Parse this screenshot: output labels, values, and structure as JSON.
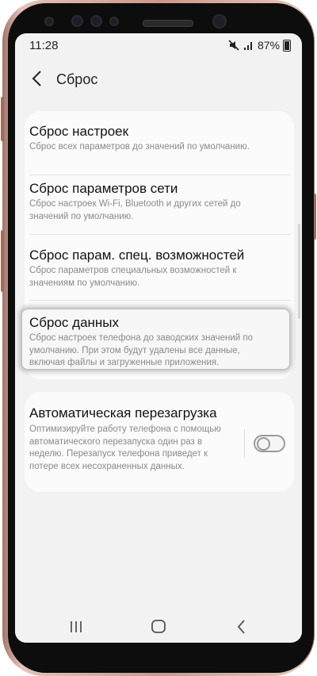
{
  "status_bar": {
    "time": "11:28",
    "battery": "87%"
  },
  "header": {
    "title": "Сброс"
  },
  "items": [
    {
      "title": "Сброс настроек",
      "description": "Сброс всех параметров до значений по умолчанию."
    },
    {
      "title": "Сброс параметров сети",
      "description": "Сброс настроек Wi-Fi, Bluetooth и других сетей до значений по умолчанию."
    },
    {
      "title": "Сброс парам. спец. возможностей",
      "description": "Сброс параметров специальных возможностей к значениям по умолчанию."
    },
    {
      "title": "Сброс данных",
      "description": "Сброс настроек телефона до заводских значений по умолчанию. При этом будут удалены все данные, включая файлы и загруженные приложения."
    }
  ],
  "auto_restart": {
    "title": "Автоматическая перезагрузка",
    "description": "Оптимизируйте работу телефона с помощью автоматического перезапуска один раз в неделю. Перезапуск телефона приведет к потере всех несохраненных данных.",
    "enabled": false
  },
  "icons": {
    "mute": "mute-icon",
    "signal": "signal-icon",
    "back": "back-arrow-icon",
    "recents": "recents-icon",
    "home": "home-icon",
    "nav_back": "nav-back-icon"
  }
}
